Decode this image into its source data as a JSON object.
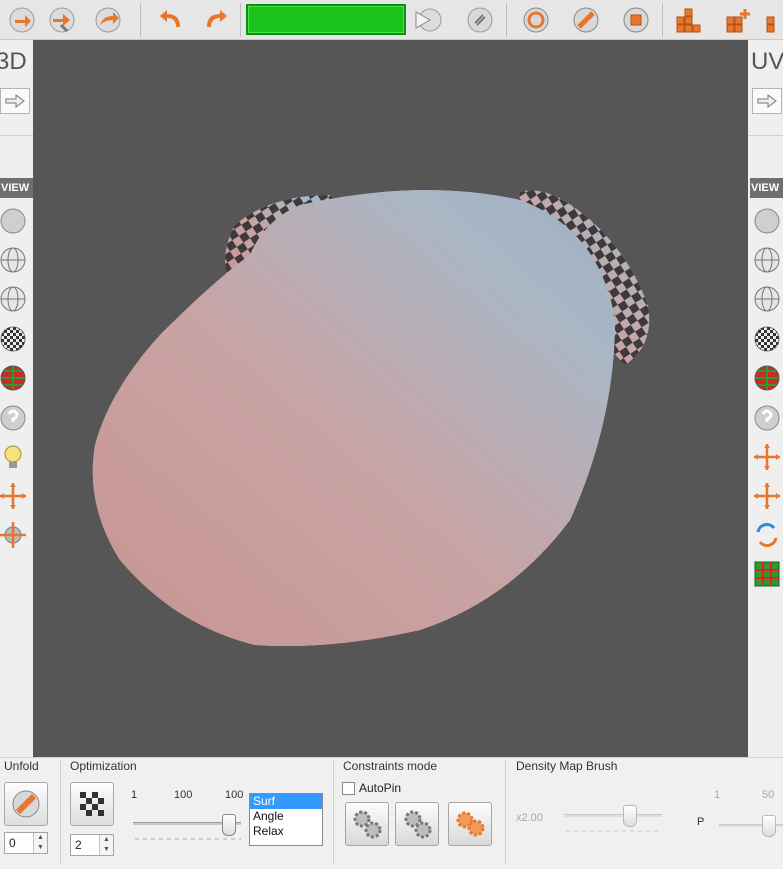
{
  "toolbar": {
    "buttons": [
      "undo-arrow-icon",
      "undo-brush-icon",
      "redo-arrow-icon",
      "undo-icon",
      "redo-icon",
      "play-icon",
      "stop-icon",
      "circle-a-icon",
      "brush-slash-icon",
      "square-stop-icon",
      "grid-icon",
      "grid-add-icon",
      "grid-edit-icon"
    ],
    "progress": 1.0,
    "progress_color": "#1bc21b"
  },
  "left_panel": {
    "title": "3D",
    "view_label": "VIEW",
    "icons": [
      "sphere-icon",
      "wire-sphere-icon",
      "wire-sphere-icon",
      "checker-sphere-icon",
      "colored-grid-sphere-icon",
      "help-sphere-icon",
      "lightbulb-icon",
      "move-arrows-icon",
      "move-rotate-icon"
    ]
  },
  "right_panel": {
    "title": "UV",
    "view_label": "VIEW",
    "icons": [
      "sphere-icon",
      "wire-sphere-icon",
      "wire-sphere-icon",
      "checker-sphere-icon",
      "colored-grid-sphere-icon",
      "help-sphere-icon",
      "move-arrows-icon",
      "move-arrows-icon",
      "2d-3d-swap-icon",
      "grid-icon"
    ]
  },
  "viewport": {
    "background": "#565656",
    "checker_dark": "#3e3a3c"
  },
  "bottom": {
    "unfold": {
      "label": "Unfold",
      "value": "0"
    },
    "optimization": {
      "label": "Optimization",
      "value": "2",
      "ticks": [
        "1",
        "100",
        "100"
      ],
      "options": [
        "Surf",
        "Angle",
        "Relax"
      ],
      "selected": "Surf"
    },
    "constraints": {
      "label": "Constraints mode",
      "autopin_label": "AutoPin",
      "autopin_checked": false
    },
    "density": {
      "label": "Density Map Brush",
      "scale_label": "x2.00",
      "p_label": "P",
      "ticks": [
        "1",
        "50"
      ]
    }
  },
  "colors": {
    "accent": "#e8762c",
    "panel_bg": "#efefef",
    "view_header": "#6f6f6f"
  }
}
